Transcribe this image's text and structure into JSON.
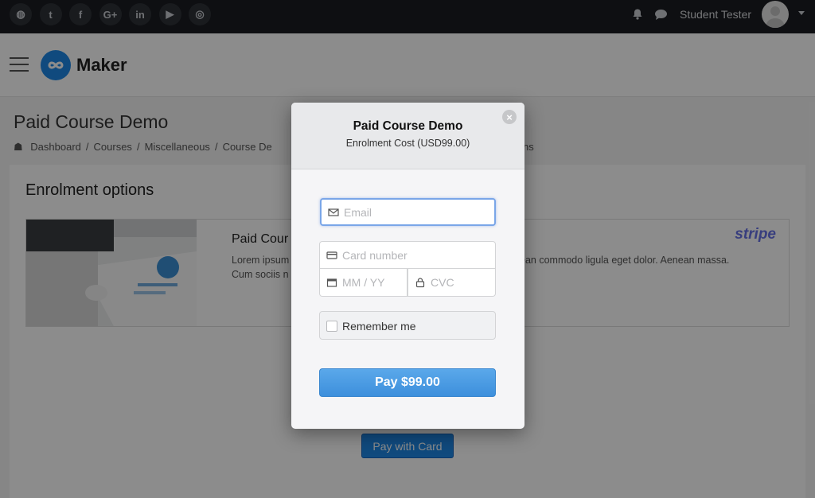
{
  "topbar": {
    "social_icons": [
      {
        "name": "globe-icon",
        "glyph": "◍"
      },
      {
        "name": "twitter-icon",
        "glyph": "t"
      },
      {
        "name": "facebook-icon",
        "glyph": "f"
      },
      {
        "name": "google-plus-icon",
        "glyph": "G+"
      },
      {
        "name": "linkedin-icon",
        "glyph": "in"
      },
      {
        "name": "youtube-icon",
        "glyph": "▶"
      },
      {
        "name": "instagram-icon",
        "glyph": "◎"
      }
    ],
    "user_name": "Student Tester"
  },
  "header": {
    "logo_text": "Maker",
    "brand_color": "#1e88e5"
  },
  "page": {
    "title": "Paid Course Demo",
    "breadcrumb": [
      "Dashboard",
      "/",
      "Courses",
      "/",
      "Miscellaneous",
      "/",
      "Course De"
    ],
    "breadcrumb_tail": "ns"
  },
  "enrolment": {
    "title": "Enrolment options",
    "course_name": "Paid Cour",
    "description_left": "Lorem ipsum",
    "description_left_2": "Cum sociis n",
    "description_right": "ean commodo ligula eget dolor. Aenean massa.",
    "stripe_label": "stripe",
    "pay_with_card": "Pay with Card"
  },
  "modal": {
    "title": "Paid Course Demo",
    "subtitle": "Enrolment Cost (USD99.00)",
    "close": "×",
    "email_placeholder": "Email",
    "card_placeholder": "Card number",
    "expiry_placeholder": "MM / YY",
    "cvc_placeholder": "CVC",
    "remember_label": "Remember me",
    "pay_label": "Pay $99.00"
  }
}
